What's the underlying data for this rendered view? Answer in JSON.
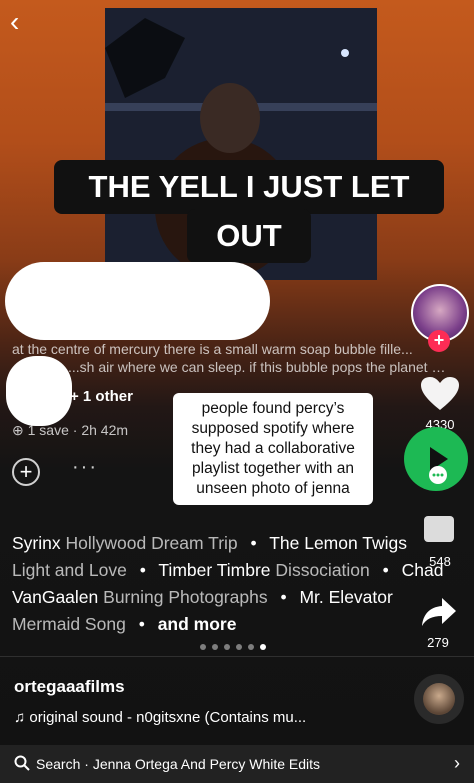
{
  "nav": {
    "back_icon": "‹"
  },
  "caption": {
    "line1": "THE YELL I JUST LET",
    "line2": "OUT"
  },
  "post": {
    "description_line1": "at the centre of mercury there is a small warm soap bubble fille...",
    "description_line2": "...sh air where we can sleep. if this bubble pops the planet w...",
    "owner_suffix": "+ 1 other",
    "meta": "1 save · 2h 42m",
    "add_icon": "+",
    "more_icon": "···"
  },
  "sticker": {
    "text": "people found percy’s supposed spotify where they had a collaborative playlist together with an unseen photo of jenna"
  },
  "sidebar": {
    "likes": "4330",
    "comments": "548",
    "shares": "279",
    "follow_plus": "+"
  },
  "tracks": {
    "row1": [
      {
        "name": "Syrinx",
        "artist": "Hollywood Dream Trip"
      },
      {
        "name": "The",
        "artist": ""
      }
    ],
    "row1_overlap": "The Lemon Twigs",
    "row2": [
      {
        "name": "Light and Love",
        "artist": ""
      },
      {
        "name": "Timber Timbre",
        "artist": "Dissociation"
      },
      {
        "name": "Chad",
        "artist": ""
      }
    ],
    "row3": [
      {
        "name": "VanGaalen",
        "artist": "Burning Photographs"
      },
      {
        "name": "Mr. Elevator",
        "artist": ""
      }
    ],
    "row4": [
      {
        "name": "Mermaid Song",
        "artist": ""
      }
    ],
    "and_more": "and more",
    "pager": {
      "count": 6,
      "active_index": 5
    }
  },
  "footer": {
    "username": "ortegaaafilms",
    "sound": "♫ original sound - n0gitsxne (Contains mu...",
    "search_prefix": "Search ·",
    "search_query": "Jenna Ortega And Percy White Edits",
    "arrow": "›"
  }
}
